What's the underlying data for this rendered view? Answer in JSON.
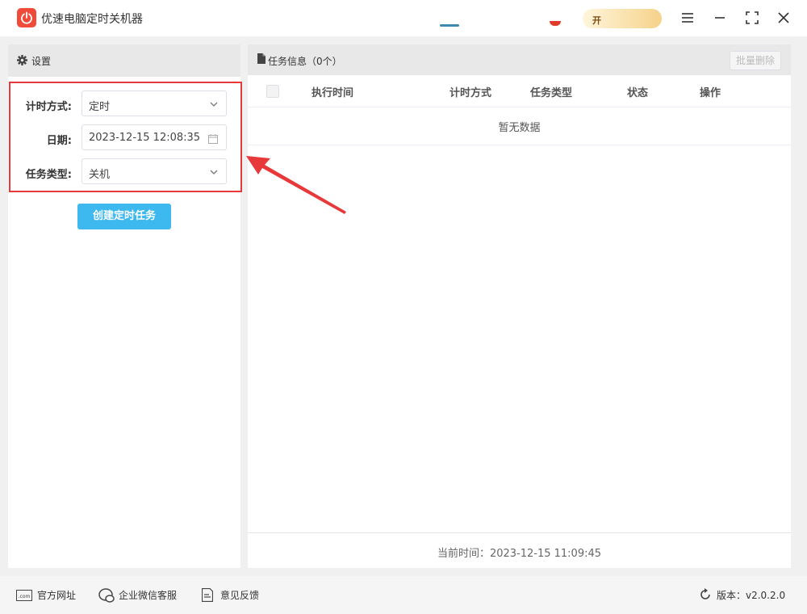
{
  "app": {
    "title": "优速电脑定时关机器"
  },
  "promo": {
    "text": "开"
  },
  "settings": {
    "header": "设置",
    "fields": [
      {
        "label": "计时方式:",
        "value": "定时"
      },
      {
        "label": "日期:",
        "value": "2023-12-15 12:08:35"
      },
      {
        "label": "任务类型:",
        "value": "关机"
      }
    ],
    "create_button": "创建定时任务"
  },
  "tasks": {
    "header": "任务信息（0个）",
    "batch_delete": "批量删除",
    "columns": [
      "执行时间",
      "计时方式",
      "任务类型",
      "状态",
      "操作"
    ],
    "empty_text": "暂无数据",
    "current_time": "当前时间：2023-12-15 11:09:45"
  },
  "statusbar": {
    "website": "官方网址",
    "wechat": "企业微信客服",
    "feedback": "意见反馈",
    "version": "版本：v2.0.2.0"
  },
  "colors": {
    "accent": "#3db9f0",
    "highlight": "#e8393a",
    "logo": "#f04a3a"
  }
}
